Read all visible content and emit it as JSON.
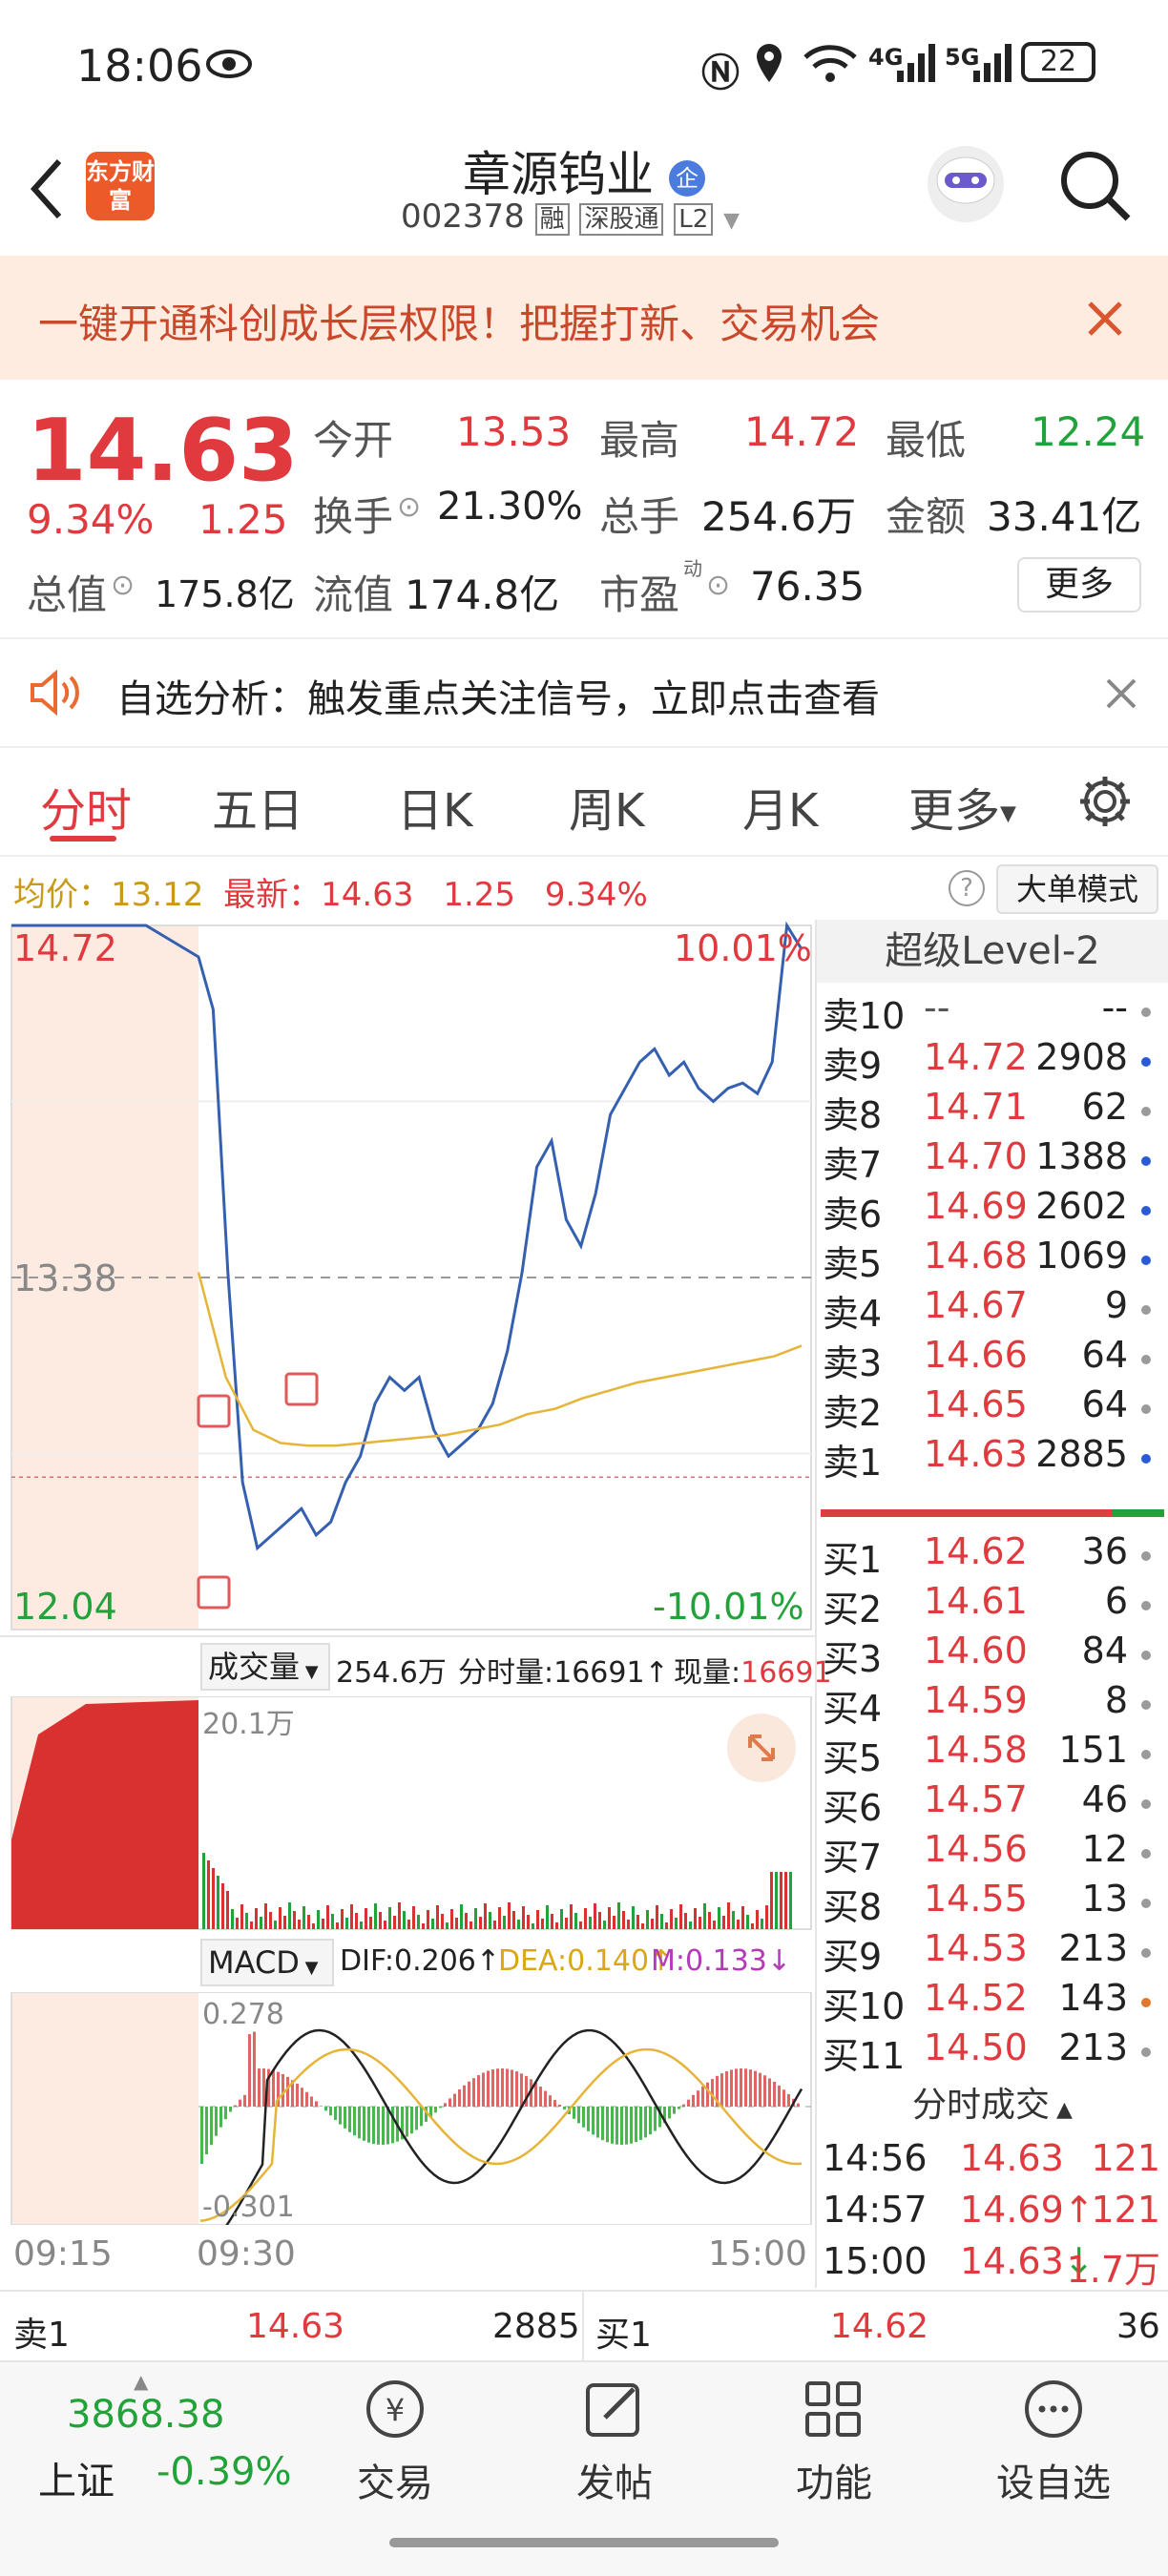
{
  "status_bar": {
    "time": "18:06",
    "network1": "4G",
    "network2": "5G",
    "battery": "22"
  },
  "header": {
    "logo_text": "东方财富",
    "stock_name": "章源钨业",
    "enterprise_badge": "企",
    "code": "002378",
    "tags": [
      "融",
      "深股通",
      "L2"
    ]
  },
  "promo": {
    "text": "一键开通科创成长层权限！把握打新、交易机会"
  },
  "quote": {
    "price": "14.63",
    "change_pct": "9.34%",
    "change": "1.25",
    "open_label": "今开",
    "open": "13.53",
    "high_label": "最高",
    "high": "14.72",
    "low_label": "最低",
    "low": "12.24",
    "turnover_label": "换手",
    "turnover": "21.30%",
    "volume_label": "总手",
    "volume": "254.6万",
    "amount_label": "金额",
    "amount": "33.41亿",
    "mcap_label": "总值",
    "mcap": "175.8亿",
    "float_label": "流值",
    "float": "174.8亿",
    "pe_label": "市盈",
    "pe_sup": "动",
    "pe": "76.35",
    "more_button": "更多"
  },
  "notice": {
    "text": "自选分析：触发重点关注信号，立即点击查看"
  },
  "tabs": [
    "分时",
    "五日",
    "日K",
    "周K",
    "月K",
    "更多"
  ],
  "tabs_active": 0,
  "info_line": {
    "avg_label": "均价：",
    "avg": "13.12",
    "latest_label": "最新：",
    "latest": "14.63",
    "chg": "1.25",
    "pct": "9.34%",
    "mode_button": "大单模式"
  },
  "chart_axis": {
    "top_price": "14.72",
    "mid_price": "13.38",
    "bottom_price": "12.04",
    "top_pct": "10.01%",
    "bottom_pct": "-10.01%",
    "x_labels": [
      "09:15",
      "09:30",
      "15:00"
    ]
  },
  "volume_bar": {
    "selector": "成交量",
    "total": "254.6万",
    "split_label": "分时量:",
    "split": "16691",
    "now_label": "现量:",
    "now": "16691",
    "max": "20.1万"
  },
  "macd_bar": {
    "selector": "MACD",
    "dif": "DIF:0.206",
    "dea": "DEA:0.140",
    "m": "M:0.133",
    "top": "0.278",
    "bottom": "-0.301"
  },
  "chart_data": [
    {
      "type": "line",
      "title": "",
      "x_labels": [
        "09:15",
        "09:30",
        "15:00"
      ],
      "ylim": [
        12.04,
        14.72
      ],
      "series": [
        {
          "values": [
            14.72,
            14.72,
            14.72,
            14.72,
            14.6,
            14.4,
            13.4,
            12.6,
            12.35,
            12.4,
            12.45,
            12.5,
            12.4,
            12.45,
            12.6,
            12.7,
            12.9,
            13.0,
            12.95,
            13.0,
            12.8,
            12.7,
            12.75,
            12.8,
            12.9,
            13.1,
            13.4,
            13.8,
            13.9,
            13.6,
            13.5,
            13.7,
            14.0,
            14.1,
            14.2,
            14.25,
            14.15,
            14.2,
            14.1,
            14.05,
            14.1,
            14.12,
            14.08,
            14.2,
            14.72,
            14.63
          ]
        },
        {
          "values": [
            13.4,
            13.0,
            12.8,
            12.75,
            12.74,
            12.74,
            12.75,
            12.76,
            12.77,
            12.78,
            12.8,
            12.82,
            12.86,
            12.88,
            12.92,
            12.95,
            12.98,
            13.0,
            13.02,
            13.04,
            13.06,
            13.08,
            13.12
          ]
        }
      ]
    }
  ],
  "level2": {
    "title": "超级Level-2",
    "asks": [
      {
        "label": "卖10",
        "price": "--",
        "vol": "--",
        "dot": "#9a9a9a"
      },
      {
        "label": "卖9",
        "price": "14.72",
        "vol": "2908",
        "dot": "#2a5bd7"
      },
      {
        "label": "卖8",
        "price": "14.71",
        "vol": "62",
        "dot": "#9a9a9a"
      },
      {
        "label": "卖7",
        "price": "14.70",
        "vol": "1388",
        "dot": "#2a5bd7"
      },
      {
        "label": "卖6",
        "price": "14.69",
        "vol": "2602",
        "dot": "#2a5bd7"
      },
      {
        "label": "卖5",
        "price": "14.68",
        "vol": "1069",
        "dot": "#2a5bd7"
      },
      {
        "label": "卖4",
        "price": "14.67",
        "vol": "9",
        "dot": "#9a9a9a"
      },
      {
        "label": "卖3",
        "price": "14.66",
        "vol": "64",
        "dot": "#9a9a9a"
      },
      {
        "label": "卖2",
        "price": "14.65",
        "vol": "64",
        "dot": "#9a9a9a"
      },
      {
        "label": "卖1",
        "price": "14.63",
        "vol": "2885",
        "dot": "#2a5bd7"
      }
    ],
    "bids": [
      {
        "label": "买1",
        "price": "14.62",
        "vol": "36",
        "dot": "#9a9a9a"
      },
      {
        "label": "买2",
        "price": "14.61",
        "vol": "6",
        "dot": "#9a9a9a"
      },
      {
        "label": "买3",
        "price": "14.60",
        "vol": "84",
        "dot": "#9a9a9a"
      },
      {
        "label": "买4",
        "price": "14.59",
        "vol": "8",
        "dot": "#9a9a9a"
      },
      {
        "label": "买5",
        "price": "14.58",
        "vol": "151",
        "dot": "#9a9a9a"
      },
      {
        "label": "买6",
        "price": "14.57",
        "vol": "46",
        "dot": "#9a9a9a"
      },
      {
        "label": "买7",
        "price": "14.56",
        "vol": "12",
        "dot": "#9a9a9a"
      },
      {
        "label": "买8",
        "price": "14.55",
        "vol": "13",
        "dot": "#9a9a9a"
      },
      {
        "label": "买9",
        "price": "14.53",
        "vol": "213",
        "dot": "#9a9a9a"
      },
      {
        "label": "买10",
        "price": "14.52",
        "vol": "143",
        "dot": "#e0792a"
      },
      {
        "label": "买11",
        "price": "14.50",
        "vol": "213",
        "dot": "#9a9a9a"
      }
    ],
    "trades_title": "分时成交",
    "trades": [
      {
        "time": "14:56",
        "price": "14.63",
        "vol": "121",
        "arrow": ""
      },
      {
        "time": "14:57",
        "price": "14.69",
        "vol": "121",
        "arrow": "↑"
      },
      {
        "time": "15:00",
        "price": "14.63",
        "vol": "1.7万",
        "arrow": "↓"
      }
    ]
  },
  "bottom_quote": {
    "ask_label": "卖1",
    "ask_price": "14.63",
    "ask_vol": "2885",
    "bid_label": "买1",
    "bid_price": "14.62",
    "bid_vol": "36"
  },
  "bottom_nav": {
    "index_value": "3868.38",
    "index_name": "上证",
    "index_change": "-0.39%",
    "items": [
      "交易",
      "发帖",
      "功能",
      "设自选"
    ]
  },
  "colors": {
    "up": "#e0393e",
    "down": "#22a33a",
    "price_line": "#3560b0",
    "avg_line": "#e6b437"
  }
}
